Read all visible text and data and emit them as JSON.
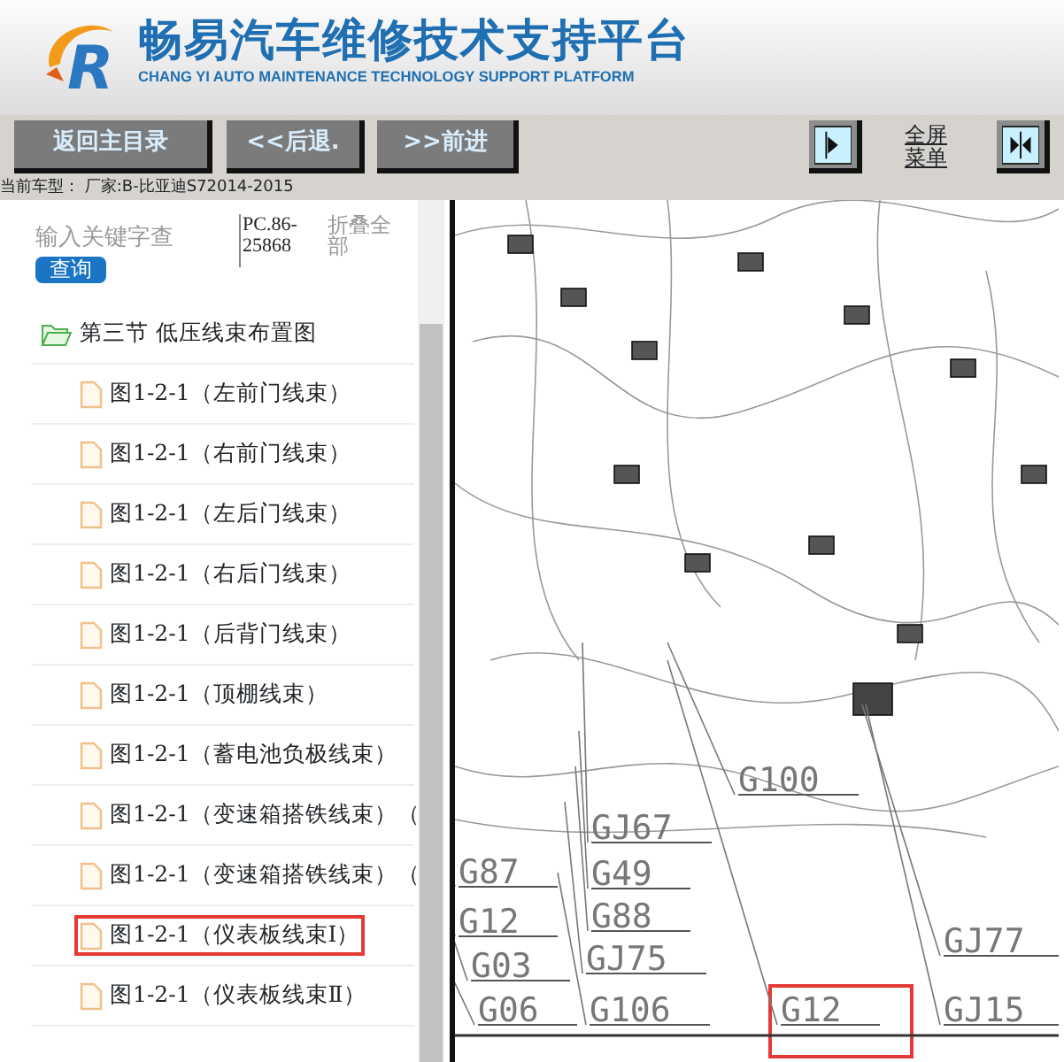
{
  "header": {
    "logo_letter": "R",
    "title": "畅易汽车维修技术支持平台",
    "subtitle": "CHANG YI AUTO MAINTENANCE TECHNOLOGY SUPPORT PLATFORM"
  },
  "toolbar": {
    "buttons": [
      "返回主目录",
      "<<后退.",
      ">>前进"
    ],
    "fullscreen_label": "全屏菜单"
  },
  "vehicle_line": "当前车型：  厂家:B-比亚迪S72014-2015",
  "sidebar": {
    "search": {
      "placeholder": "输入关键字查"
    },
    "search_button": "查询",
    "code": "PC.86-25868",
    "collapse_all": "折叠全部",
    "tree": [
      {
        "label": "第三节 低压线束布置图",
        "kind": "folder",
        "highlighted": false,
        "children": [
          {
            "label": "图1-2-1（左前门线束）",
            "kind": "file",
            "highlighted": false
          },
          {
            "label": "图1-2-1（右前门线束）",
            "kind": "file",
            "highlighted": false
          },
          {
            "label": "图1-2-1（左后门线束）",
            "kind": "file",
            "highlighted": false
          },
          {
            "label": "图1-2-1（右后门线束）",
            "kind": "file",
            "highlighted": false
          },
          {
            "label": "图1-2-1（后背门线束）",
            "kind": "file",
            "highlighted": false
          },
          {
            "label": "图1-2-1（顶棚线束）",
            "kind": "file",
            "highlighted": false
          },
          {
            "label": "图1-2-1（蓄电池负极线束）",
            "kind": "file",
            "highlighted": false
          },
          {
            "label": "图1-2-1（变速箱搭铁线束）（",
            "kind": "file",
            "highlighted": false
          },
          {
            "label": "图1-2-1（变速箱搭铁线束）（",
            "kind": "file",
            "highlighted": false
          },
          {
            "label": "图1-2-1（仪表板线束Ⅰ）",
            "kind": "file",
            "highlighted": true
          },
          {
            "label": "图1-2-1（仪表板线束Ⅱ）",
            "kind": "file",
            "highlighted": false
          }
        ]
      }
    ]
  },
  "diagram": {
    "labels": [
      {
        "text": "G100",
        "highlighted": false
      },
      {
        "text": "GJ67",
        "highlighted": false
      },
      {
        "text": "G87",
        "highlighted": false
      },
      {
        "text": "G49",
        "highlighted": false
      },
      {
        "text": "G12",
        "highlighted": false
      },
      {
        "text": "G88",
        "highlighted": false
      },
      {
        "text": "G03",
        "highlighted": false
      },
      {
        "text": "GJ75",
        "highlighted": false
      },
      {
        "text": "GJ77",
        "highlighted": false
      },
      {
        "text": "G06",
        "highlighted": false
      },
      {
        "text": "G106",
        "highlighted": false
      },
      {
        "text": "G12",
        "highlighted": true
      },
      {
        "text": "GJ15",
        "highlighted": false
      }
    ]
  }
}
